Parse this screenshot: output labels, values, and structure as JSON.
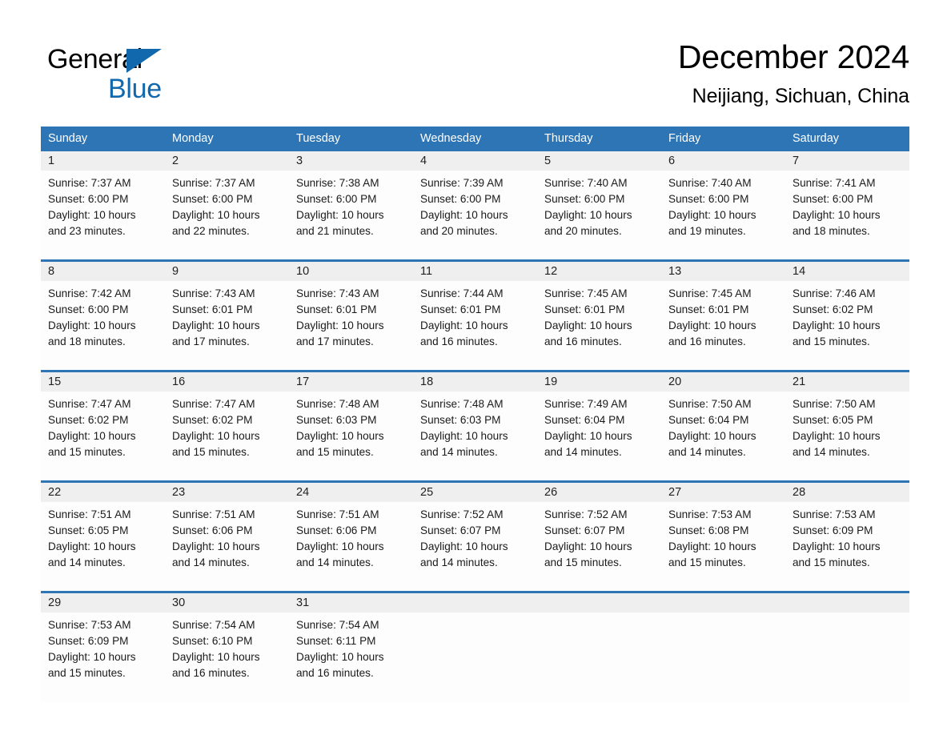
{
  "brand": {
    "name_part1": "General",
    "name_part2": "Blue",
    "flag_icon": "triangle-flag-icon",
    "accent_color": "#1168ad"
  },
  "header": {
    "title": "December 2024",
    "location": "Neijiang, Sichuan, China"
  },
  "theme": {
    "header_blue": "#2e75b6",
    "daynum_band_gray": "#efefef",
    "cell_background": "#fdfdfd",
    "text_color": "#1a1a1a"
  },
  "calendar": {
    "weekday_headers": [
      "Sunday",
      "Monday",
      "Tuesday",
      "Wednesday",
      "Thursday",
      "Friday",
      "Saturday"
    ],
    "weeks": [
      {
        "days": [
          {
            "num": "1",
            "sunrise": "Sunrise: 7:37 AM",
            "sunset": "Sunset: 6:00 PM",
            "daylight1": "Daylight: 10 hours",
            "daylight2": "and 23 minutes."
          },
          {
            "num": "2",
            "sunrise": "Sunrise: 7:37 AM",
            "sunset": "Sunset: 6:00 PM",
            "daylight1": "Daylight: 10 hours",
            "daylight2": "and 22 minutes."
          },
          {
            "num": "3",
            "sunrise": "Sunrise: 7:38 AM",
            "sunset": "Sunset: 6:00 PM",
            "daylight1": "Daylight: 10 hours",
            "daylight2": "and 21 minutes."
          },
          {
            "num": "4",
            "sunrise": "Sunrise: 7:39 AM",
            "sunset": "Sunset: 6:00 PM",
            "daylight1": "Daylight: 10 hours",
            "daylight2": "and 20 minutes."
          },
          {
            "num": "5",
            "sunrise": "Sunrise: 7:40 AM",
            "sunset": "Sunset: 6:00 PM",
            "daylight1": "Daylight: 10 hours",
            "daylight2": "and 20 minutes."
          },
          {
            "num": "6",
            "sunrise": "Sunrise: 7:40 AM",
            "sunset": "Sunset: 6:00 PM",
            "daylight1": "Daylight: 10 hours",
            "daylight2": "and 19 minutes."
          },
          {
            "num": "7",
            "sunrise": "Sunrise: 7:41 AM",
            "sunset": "Sunset: 6:00 PM",
            "daylight1": "Daylight: 10 hours",
            "daylight2": "and 18 minutes."
          }
        ]
      },
      {
        "days": [
          {
            "num": "8",
            "sunrise": "Sunrise: 7:42 AM",
            "sunset": "Sunset: 6:00 PM",
            "daylight1": "Daylight: 10 hours",
            "daylight2": "and 18 minutes."
          },
          {
            "num": "9",
            "sunrise": "Sunrise: 7:43 AM",
            "sunset": "Sunset: 6:01 PM",
            "daylight1": "Daylight: 10 hours",
            "daylight2": "and 17 minutes."
          },
          {
            "num": "10",
            "sunrise": "Sunrise: 7:43 AM",
            "sunset": "Sunset: 6:01 PM",
            "daylight1": "Daylight: 10 hours",
            "daylight2": "and 17 minutes."
          },
          {
            "num": "11",
            "sunrise": "Sunrise: 7:44 AM",
            "sunset": "Sunset: 6:01 PM",
            "daylight1": "Daylight: 10 hours",
            "daylight2": "and 16 minutes."
          },
          {
            "num": "12",
            "sunrise": "Sunrise: 7:45 AM",
            "sunset": "Sunset: 6:01 PM",
            "daylight1": "Daylight: 10 hours",
            "daylight2": "and 16 minutes."
          },
          {
            "num": "13",
            "sunrise": "Sunrise: 7:45 AM",
            "sunset": "Sunset: 6:01 PM",
            "daylight1": "Daylight: 10 hours",
            "daylight2": "and 16 minutes."
          },
          {
            "num": "14",
            "sunrise": "Sunrise: 7:46 AM",
            "sunset": "Sunset: 6:02 PM",
            "daylight1": "Daylight: 10 hours",
            "daylight2": "and 15 minutes."
          }
        ]
      },
      {
        "days": [
          {
            "num": "15",
            "sunrise": "Sunrise: 7:47 AM",
            "sunset": "Sunset: 6:02 PM",
            "daylight1": "Daylight: 10 hours",
            "daylight2": "and 15 minutes."
          },
          {
            "num": "16",
            "sunrise": "Sunrise: 7:47 AM",
            "sunset": "Sunset: 6:02 PM",
            "daylight1": "Daylight: 10 hours",
            "daylight2": "and 15 minutes."
          },
          {
            "num": "17",
            "sunrise": "Sunrise: 7:48 AM",
            "sunset": "Sunset: 6:03 PM",
            "daylight1": "Daylight: 10 hours",
            "daylight2": "and 15 minutes."
          },
          {
            "num": "18",
            "sunrise": "Sunrise: 7:48 AM",
            "sunset": "Sunset: 6:03 PM",
            "daylight1": "Daylight: 10 hours",
            "daylight2": "and 14 minutes."
          },
          {
            "num": "19",
            "sunrise": "Sunrise: 7:49 AM",
            "sunset": "Sunset: 6:04 PM",
            "daylight1": "Daylight: 10 hours",
            "daylight2": "and 14 minutes."
          },
          {
            "num": "20",
            "sunrise": "Sunrise: 7:50 AM",
            "sunset": "Sunset: 6:04 PM",
            "daylight1": "Daylight: 10 hours",
            "daylight2": "and 14 minutes."
          },
          {
            "num": "21",
            "sunrise": "Sunrise: 7:50 AM",
            "sunset": "Sunset: 6:05 PM",
            "daylight1": "Daylight: 10 hours",
            "daylight2": "and 14 minutes."
          }
        ]
      },
      {
        "days": [
          {
            "num": "22",
            "sunrise": "Sunrise: 7:51 AM",
            "sunset": "Sunset: 6:05 PM",
            "daylight1": "Daylight: 10 hours",
            "daylight2": "and 14 minutes."
          },
          {
            "num": "23",
            "sunrise": "Sunrise: 7:51 AM",
            "sunset": "Sunset: 6:06 PM",
            "daylight1": "Daylight: 10 hours",
            "daylight2": "and 14 minutes."
          },
          {
            "num": "24",
            "sunrise": "Sunrise: 7:51 AM",
            "sunset": "Sunset: 6:06 PM",
            "daylight1": "Daylight: 10 hours",
            "daylight2": "and 14 minutes."
          },
          {
            "num": "25",
            "sunrise": "Sunrise: 7:52 AM",
            "sunset": "Sunset: 6:07 PM",
            "daylight1": "Daylight: 10 hours",
            "daylight2": "and 14 minutes."
          },
          {
            "num": "26",
            "sunrise": "Sunrise: 7:52 AM",
            "sunset": "Sunset: 6:07 PM",
            "daylight1": "Daylight: 10 hours",
            "daylight2": "and 15 minutes."
          },
          {
            "num": "27",
            "sunrise": "Sunrise: 7:53 AM",
            "sunset": "Sunset: 6:08 PM",
            "daylight1": "Daylight: 10 hours",
            "daylight2": "and 15 minutes."
          },
          {
            "num": "28",
            "sunrise": "Sunrise: 7:53 AM",
            "sunset": "Sunset: 6:09 PM",
            "daylight1": "Daylight: 10 hours",
            "daylight2": "and 15 minutes."
          }
        ]
      },
      {
        "days": [
          {
            "num": "29",
            "sunrise": "Sunrise: 7:53 AM",
            "sunset": "Sunset: 6:09 PM",
            "daylight1": "Daylight: 10 hours",
            "daylight2": "and 15 minutes."
          },
          {
            "num": "30",
            "sunrise": "Sunrise: 7:54 AM",
            "sunset": "Sunset: 6:10 PM",
            "daylight1": "Daylight: 10 hours",
            "daylight2": "and 16 minutes."
          },
          {
            "num": "31",
            "sunrise": "Sunrise: 7:54 AM",
            "sunset": "Sunset: 6:11 PM",
            "daylight1": "Daylight: 10 hours",
            "daylight2": "and 16 minutes."
          },
          {
            "num": "",
            "sunrise": "",
            "sunset": "",
            "daylight1": "",
            "daylight2": ""
          },
          {
            "num": "",
            "sunrise": "",
            "sunset": "",
            "daylight1": "",
            "daylight2": ""
          },
          {
            "num": "",
            "sunrise": "",
            "sunset": "",
            "daylight1": "",
            "daylight2": ""
          },
          {
            "num": "",
            "sunrise": "",
            "sunset": "",
            "daylight1": "",
            "daylight2": ""
          }
        ]
      }
    ]
  }
}
